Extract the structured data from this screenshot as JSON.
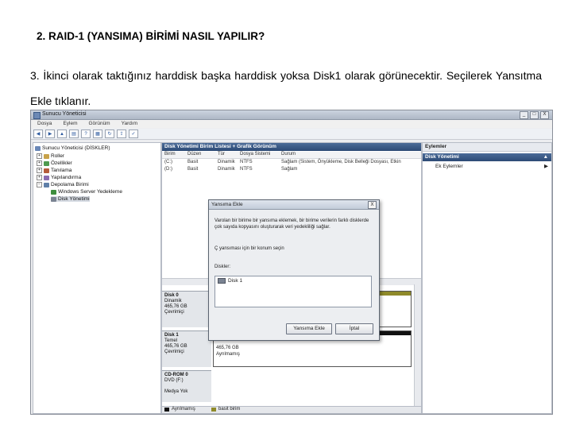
{
  "doc": {
    "title": "2. RAID-1 (YANSIMA) BİRİMİ NASIL YAPILIR?",
    "paragraph": "3. İkinci olarak taktığınız harddisk başka harddisk yoksa Disk1 olarak görünecektir. Seçilerek Yansıtma Ekle tıklanır."
  },
  "window": {
    "title": "Sunucu Yöneticisi",
    "buttons": [
      "_",
      "□",
      "X"
    ],
    "menu": [
      "Dosya",
      "Eylem",
      "Görünüm",
      "Yardım"
    ]
  },
  "tree": [
    {
      "label": "Sunucu Yöneticisi (DİSKLER)",
      "icon": "server-icon",
      "color": "#6a88b8"
    },
    {
      "label": "Roller",
      "icon": "roles-icon",
      "color": "#c8a24a"
    },
    {
      "label": "Özellikler",
      "icon": "features-icon",
      "color": "#4e9a4e"
    },
    {
      "label": "Tanılama",
      "icon": "diagnostics-icon",
      "color": "#b55b3b"
    },
    {
      "label": "Yapılandırma",
      "icon": "config-icon",
      "color": "#8a6bb0"
    },
    {
      "label": "Depolama Birimi",
      "icon": "storage-icon",
      "color": "#5f7fa8"
    },
    {
      "label": "Windows Server Yedekleme",
      "icon": "backup-icon",
      "color": "#3e8e3e"
    },
    {
      "label": "Disk Yönetimi",
      "icon": "disk-icon",
      "color": "#7a8392"
    }
  ],
  "center": {
    "header": "Disk Yönetimi  Birim Listesi + Grafik Görünüm",
    "columns": [
      "Birim",
      "Düzen",
      "Tür",
      "Dosya Sistemi",
      "Durum"
    ],
    "rows": [
      [
        "(C:)",
        "Basit",
        "Dinamik",
        "NTFS",
        "Sağlam (Sistem, Önyükleme, Disk Belleği Dosyası, Etkin"
      ],
      [
        "(D:)",
        "Basit",
        "Dinamik",
        "NTFS",
        "Sağlam"
      ]
    ],
    "disks": [
      {
        "name": "Disk 0",
        "type": "Dinamik",
        "size": "465,76 GB",
        "state": "Çevrimiçi"
      },
      {
        "name": "Disk 1",
        "type": "Temel",
        "size": "465,76 GB",
        "state": "Çevrimiçi"
      },
      {
        "name": "CD-ROM 0",
        "type": "DVD (F:)",
        "size": "",
        "state": "Medya Yok"
      }
    ],
    "disk1_partition": {
      "size": "465,76 GB",
      "state": "Ayrılmamış"
    },
    "legend": [
      "Ayrılmamış",
      "basit birim"
    ],
    "legend_colors": [
      "#111111",
      "#8f8a2a"
    ]
  },
  "actions": {
    "header": "Eylemler",
    "section": "Disk Yönetimi",
    "item": "Ek Eylemler"
  },
  "dialog": {
    "title": "Yansıma Ekle",
    "close": "X",
    "description": "Varolan bir birime bir yansıma eklemek, bir birime verilerin farklı disklerde çok sayıda kopyasını oluşturarak veri yedekliliği sağlar.",
    "prompt": "Ç yansıması için bir konum seçin",
    "list_label": "Diskler:",
    "list_items": [
      "Disk 1"
    ],
    "ok_label": "Yansıma Ekle",
    "cancel_label": "İptal"
  },
  "colors": {
    "header_blue": "#2c4a75",
    "partition_bar": "#8f8a2a"
  }
}
